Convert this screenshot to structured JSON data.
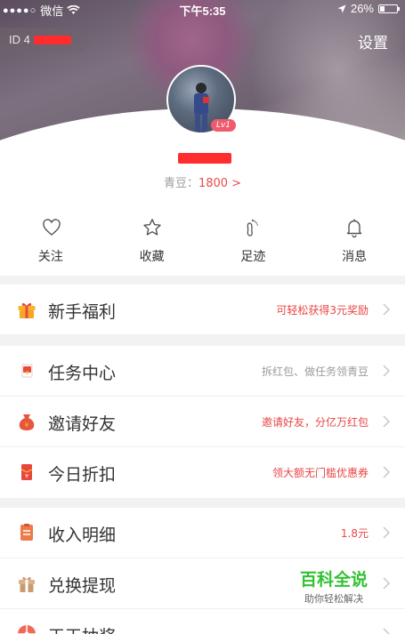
{
  "status_bar": {
    "carrier": "微信",
    "signal": "●●●●○",
    "time": "下午5:35",
    "battery": "26%",
    "battery_level": 0.26
  },
  "profile": {
    "id_label": "ID 4",
    "settings_label": "设置",
    "level_badge": "Lv1",
    "beans_label": "青豆：",
    "beans_value": "1800 >"
  },
  "quick_actions": [
    {
      "label": "关注",
      "icon": "heart-icon"
    },
    {
      "label": "收藏",
      "icon": "star-icon"
    },
    {
      "label": "足迹",
      "icon": "footprint-icon"
    },
    {
      "label": "消息",
      "icon": "bell-icon"
    }
  ],
  "menu": {
    "newbie": {
      "title": "新手福利",
      "hint": "可轻松获得3元奖励",
      "icon": "gift-icon"
    },
    "tasks": {
      "title": "任务中心",
      "hint": "拆红包、做任务领青豆",
      "icon": "red-envelope-icon"
    },
    "invite": {
      "title": "邀请好友",
      "hint": "邀请好友，分亿万红包",
      "icon": "money-bag-icon"
    },
    "discount": {
      "title": "今日折扣",
      "hint": "领大额无门槛优惠券",
      "icon": "coupon-icon"
    },
    "income": {
      "title": "收入明细",
      "hint": "1.8元",
      "icon": "ledger-icon"
    },
    "withdraw": {
      "title": "兑换提现",
      "hint": "",
      "icon": "gift-box-icon"
    },
    "lottery": {
      "title": "天天抽奖",
      "icon": "wheel-icon"
    }
  },
  "watermark": {
    "line1": "百科全说",
    "line2": "助你轻松解决"
  },
  "colors": {
    "accent_red": "#e94545",
    "watermark_green": "#32c232"
  }
}
